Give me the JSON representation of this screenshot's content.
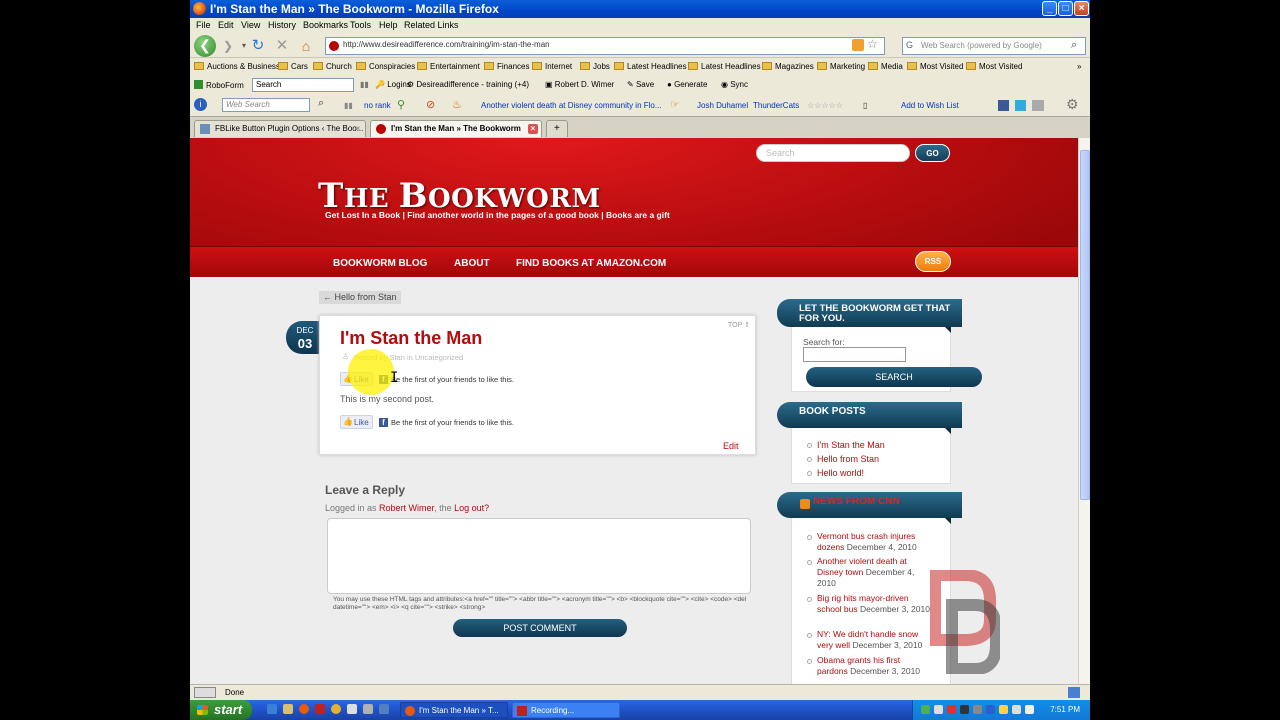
{
  "window": {
    "title": "I'm Stan the Man » The Bookworm - Mozilla Firefox",
    "controls": [
      "_",
      "□",
      "×"
    ]
  },
  "menu": [
    "File",
    "Edit",
    "View",
    "History",
    "Bookmarks",
    "Tools",
    "Help",
    "Related Links"
  ],
  "nav": {
    "url": "http://www.desireadifference.com/training/im-stan-the-man",
    "web_search_placeholder": "Web Search (powered by Google)"
  },
  "bookmarks": [
    "Auctions & Business",
    "Cars",
    "Church",
    "Conspiracies",
    "Entertainment",
    "Finances",
    "Internet",
    "Jobs",
    "Latest Headlines",
    "Latest Headlines",
    "Magazines",
    "Marketing",
    "Media",
    "Most Visited",
    "Most Visited"
  ],
  "roboform": {
    "label": "RoboForm",
    "search": "Search",
    "logins": "Logins",
    "identity": "Desireadifference - training (+4)",
    "user": "Robert D. Wimer",
    "save": "Save",
    "generate": "Generate",
    "sync": "Sync"
  },
  "websearch_bar": {
    "placeholder": "Web Search",
    "rank": "no rank",
    "news": "Another violent death at Disney community in Flo...",
    "person": "Josh Duhamel",
    "thundercats": "ThunderCats",
    "wishlist": "Add to Wish List"
  },
  "tabs": [
    {
      "label": "FBLike Button Plugin Options ‹ The Boo...",
      "active": false
    },
    {
      "label": "I'm Stan the Man » The Bookworm",
      "active": true
    }
  ],
  "site": {
    "title": "The Bookworm",
    "tagline": "Get Lost In a Book | Find another world in the pages of a good book | Books are a gift",
    "search_placeholder": "Search",
    "go": "GO",
    "nav": [
      "BOOKWORM BLOG",
      "ABOUT",
      "FIND BOOKS AT AMAZON.COM"
    ],
    "rss": "RSS"
  },
  "post": {
    "back_link": "← Hello from Stan",
    "month": "DEC",
    "day": "03",
    "title": "I'm Stan the Man",
    "meta": "Posted by Stan in Uncategorized",
    "top": "TOP ⇑",
    "like": "Like",
    "fb_text": "Be the first of your friends to like this.",
    "body": "This is my second post.",
    "edit": "Edit"
  },
  "reply": {
    "title": "Leave a Reply",
    "logged_prefix": "Logged in as ",
    "user": "Robert Wimer",
    "logout": "Log out?",
    "sep": ", the ",
    "tags": "You may use these HTML tags and attributes:<a href=\"\" title=\"\"> <abbr title=\"\"> <acronym title=\"\"> <b> <blockquote cite=\"\"> <cite> <code> <del datetime=\"\"> <em> <i> <q cite=\"\"> <strike> <strong>",
    "button": "POST COMMENT"
  },
  "sidebar": {
    "search_heading": "LET THE BOOKWORM GET THAT FOR YOU.",
    "search_label": "Search for:",
    "search_button": "SEARCH",
    "posts_heading": "BOOK POSTS",
    "posts": [
      "I'm Stan the Man",
      "Hello from Stan",
      "Hello world!"
    ],
    "news_heading": "NEWS FROM CNN",
    "news": [
      {
        "title": "Vermont bus crash injures dozens",
        "date": "December 4, 2010"
      },
      {
        "title": "Another violent death at Disney town",
        "date": "December 4, 2010"
      },
      {
        "title": "Big rig hits mayor-driven school bus",
        "date": "December 3, 2010"
      },
      {
        "title": "NY: We didn't handle snow very well",
        "date": "December 3, 2010"
      },
      {
        "title": "Obama grants his first pardons",
        "date": "December 3, 2010"
      }
    ]
  },
  "status": {
    "text": "Done"
  },
  "taskbar": {
    "start": "start",
    "tasks": [
      "I'm Stan the Man » T...",
      "Recording..."
    ],
    "clock": "7:51 PM"
  },
  "colors": {
    "brand_red": "#b40c0e",
    "accent_blue": "#154a66",
    "xp_blue": "#245edb"
  }
}
